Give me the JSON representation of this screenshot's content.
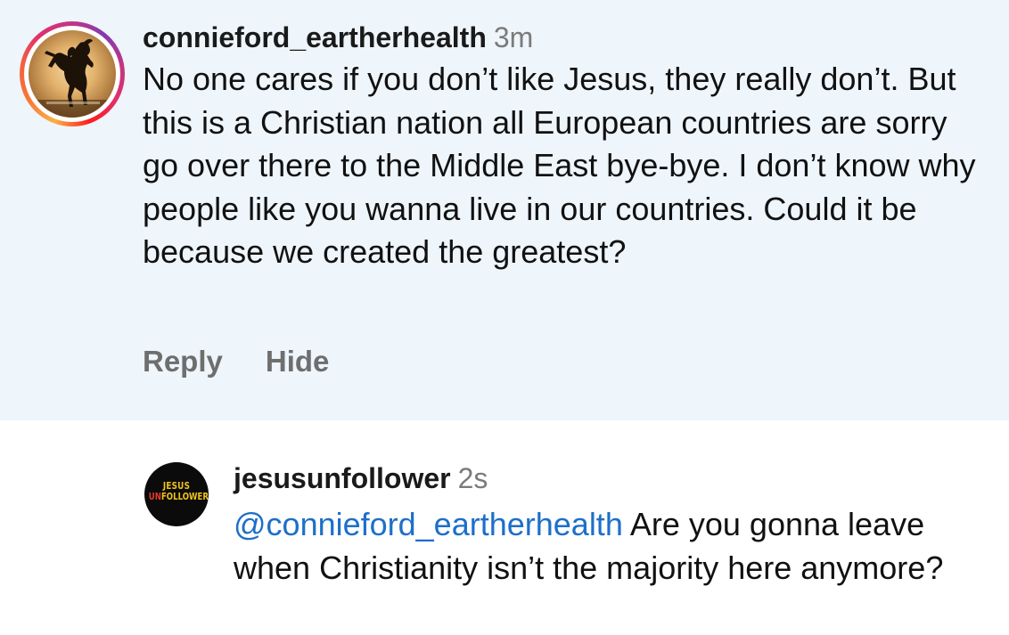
{
  "comments": [
    {
      "username": "connieford_eartherhealth",
      "time": "3m",
      "text": "No one cares if you don’t like Jesus, they really don’t. But this is a Christian nation all European countries are sorry go over there to the Middle East bye-bye. I don’t know why people like you wanna live in our countries. Could it be because we created the greatest?",
      "actions": {
        "reply": "Reply",
        "hide": "Hide"
      }
    },
    {
      "username": "jesusunfollower",
      "time": "2s",
      "mention": "@connieford_eartherhealth",
      "text": " Are you gonna leave when Christianity isn’t the majority here anymore?",
      "avatar_logo": {
        "line1": "JESUS",
        "line2_prefix": "UN",
        "line2_rest": "FOLLOWER"
      }
    }
  ],
  "colors": {
    "highlight_background": "#eef5fb",
    "mention": "#1d6fc9",
    "secondary_text": "#7b7b7b",
    "action_text": "#6e6e6e"
  }
}
